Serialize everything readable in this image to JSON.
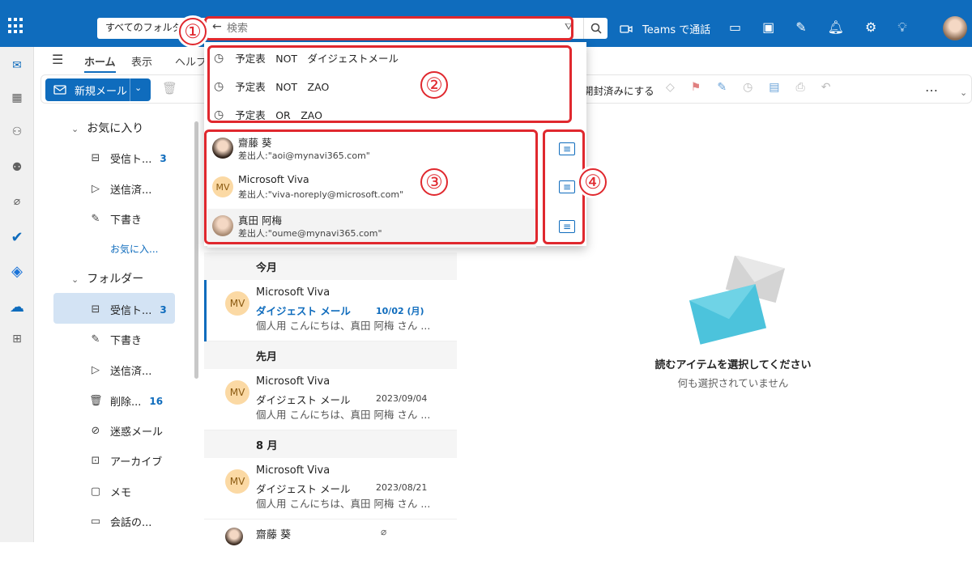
{
  "topbar": {
    "scope_label": "すべてのフォルダー",
    "search_placeholder": "検索",
    "teams_label": "Teams で通話"
  },
  "rail": {
    "icons": [
      "mail-icon",
      "calendar-icon",
      "people-icon",
      "groups-icon",
      "attach-icon",
      "todo-icon",
      "teams-icon",
      "onedrive-icon",
      "apps-icon"
    ]
  },
  "ribbon": {
    "tabs": [
      "ホーム",
      "表示",
      "ヘルプ"
    ],
    "new_mail": "新規メール",
    "mark_read": "開封済みにする",
    "more": "…"
  },
  "folders": {
    "favorites_header": "お気に入り",
    "favorites": [
      {
        "label": "受信ト...",
        "count": "3"
      },
      {
        "label": "送信済...",
        "count": ""
      },
      {
        "label": "下書き",
        "count": ""
      },
      {
        "label": "お気に入...",
        "count": ""
      }
    ],
    "folders_header": "フォルダー",
    "items": [
      {
        "label": "受信ト...",
        "count": "3"
      },
      {
        "label": "下書き",
        "count": ""
      },
      {
        "label": "送信済...",
        "count": ""
      },
      {
        "label": "削除...",
        "count": "16"
      },
      {
        "label": "迷惑メール",
        "count": ""
      },
      {
        "label": "アーカイブ",
        "count": ""
      },
      {
        "label": "メモ",
        "count": ""
      },
      {
        "label": "会話の...",
        "count": ""
      }
    ]
  },
  "suggestions": [
    "予定表　NOT　ダイジェストメール",
    "予定表　NOT　ZAO",
    "予定表　OR　ZAO"
  ],
  "people": [
    {
      "name": "齋藤 葵",
      "email": "差出人:\"aoi@mynavi365.com\""
    },
    {
      "name": "Microsoft Viva",
      "email": "差出人:\"viva-noreply@microsoft.com\"",
      "initials": "MV"
    },
    {
      "name": "真田 阿梅",
      "email": "差出人:\"oume@mynavi365.com\""
    }
  ],
  "messages": {
    "groups": [
      "今月",
      "先月",
      "8 月"
    ],
    "items": [
      {
        "initials": "MV",
        "from": "Microsoft Viva",
        "subject": "ダイジェスト メール",
        "date": "10/02 (月)",
        "preview": "個人用 こんにちは、真田 阿梅 さん ..."
      },
      {
        "initials": "MV",
        "from": "Microsoft Viva",
        "subject": "ダイジェスト メール",
        "date": "2023/09/04",
        "preview": "個人用 こんにちは、真田 阿梅 さん ..."
      },
      {
        "initials": "MV",
        "from": "Microsoft Viva",
        "subject": "ダイジェスト メール",
        "date": "2023/08/21",
        "preview": "個人用 こんにちは、真田 阿梅 さん ..."
      },
      {
        "from": "齋藤 葵"
      }
    ]
  },
  "reading": {
    "title": "読むアイテムを選択してください",
    "subtitle": "何も選択されていません"
  },
  "callouts": [
    "①",
    "②",
    "③",
    "④"
  ]
}
